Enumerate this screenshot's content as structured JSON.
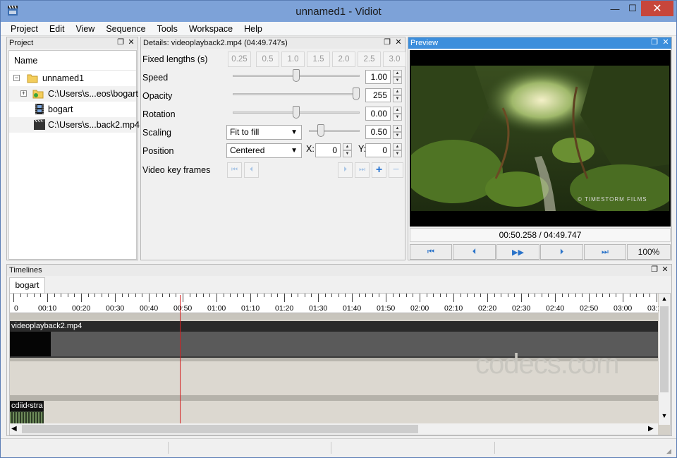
{
  "window": {
    "title": "unnamed1 - Vidiot",
    "minimize": "—",
    "maximize": "☐",
    "close": "✕"
  },
  "menu": [
    "Project",
    "Edit",
    "View",
    "Sequence",
    "Tools",
    "Workspace",
    "Help"
  ],
  "project_panel": {
    "title": "Project",
    "column": "Name",
    "items": [
      {
        "label": "unnamed1",
        "icon": "folder-icon"
      },
      {
        "label": "C:\\Users\\s...eos\\bogart",
        "icon": "auto-folder-icon"
      },
      {
        "label": "bogart",
        "icon": "sequence-film-icon"
      },
      {
        "label": "C:\\Users\\s...back2.mp4",
        "icon": "video-file-icon"
      }
    ]
  },
  "details_panel": {
    "title": "Details: videoplayback2.mp4 (04:49.747s)",
    "fixed_lengths_label": "Fixed lengths (s)",
    "fixed_lengths": [
      "0.25",
      "0.5",
      "1.0",
      "1.5",
      "2.0",
      "2.5",
      "3.0"
    ],
    "speed": {
      "label": "Speed",
      "value": "1.00",
      "position": 0.5
    },
    "opacity": {
      "label": "Opacity",
      "value": "255",
      "position": 1.0
    },
    "rotation": {
      "label": "Rotation",
      "value": "0.00",
      "position": 0.5
    },
    "scaling": {
      "label": "Scaling",
      "mode": "Fit to fill",
      "value": "0.50",
      "position": 0.2
    },
    "position": {
      "label": "Position",
      "mode": "Centered",
      "x_label": "X:",
      "x": "0",
      "y_label": "Y:",
      "y": "0"
    },
    "keyframes_label": "Video key frames"
  },
  "preview_panel": {
    "title": "Preview",
    "watermark": "© TIMESTORM FILMS",
    "timecode": "00:50.258 / 04:49.747",
    "zoom": "100%"
  },
  "timelines_panel": {
    "title": "Timelines",
    "tab": "bogart",
    "ruler_labels": [
      "0",
      "00:10",
      "00:20",
      "00:30",
      "00:40",
      "00:50",
      "01:00",
      "01:10",
      "01:20",
      "01:30",
      "01:40",
      "01:50",
      "02:00",
      "02:10",
      "02:20",
      "02:30",
      "02:40",
      "02:50",
      "03:00",
      "03:1"
    ],
    "video_clip": "videoplayback2.mp4",
    "audio_clip": "cdiid‹stra",
    "overlay_watermark": "codecs.com"
  },
  "colors": {
    "accent": "#3c8edc",
    "cursor": "#d42020",
    "title_bar": "#7da2d8"
  }
}
